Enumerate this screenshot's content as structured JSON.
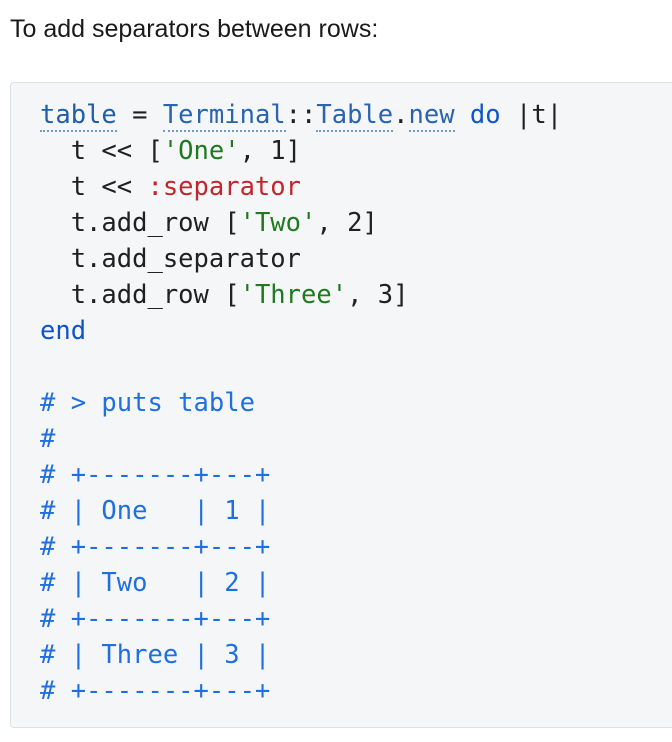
{
  "intro_text": "To add separators between rows:",
  "code": {
    "line1": {
      "var": "table",
      "assign": " = ",
      "const_a": "Terminal",
      "scope": "::",
      "const_b": "Table",
      "dot": ".",
      "method": "new",
      "space": " ",
      "kw_do": "do",
      "block": " |t|"
    },
    "line2": {
      "pre": "  t << [",
      "str": "'One'",
      "post": ", 1]"
    },
    "line3": {
      "pre": "  t << ",
      "sym": ":separator"
    },
    "line4": {
      "pre": "  t.add_row [",
      "str": "'Two'",
      "post": ", 2]"
    },
    "line5": {
      "text": "  t.add_separator"
    },
    "line6": {
      "pre": "  t.add_row [",
      "str": "'Three'",
      "post": ", 3]"
    },
    "line7": {
      "kw_end": "end"
    },
    "comments": [
      "# > puts table",
      "#",
      "# +-------+---+",
      "# | One   | 1 |",
      "# +-------+---+",
      "# | Two   | 2 |",
      "# +-------+---+",
      "# | Three | 3 |",
      "# +-------+---+"
    ]
  }
}
